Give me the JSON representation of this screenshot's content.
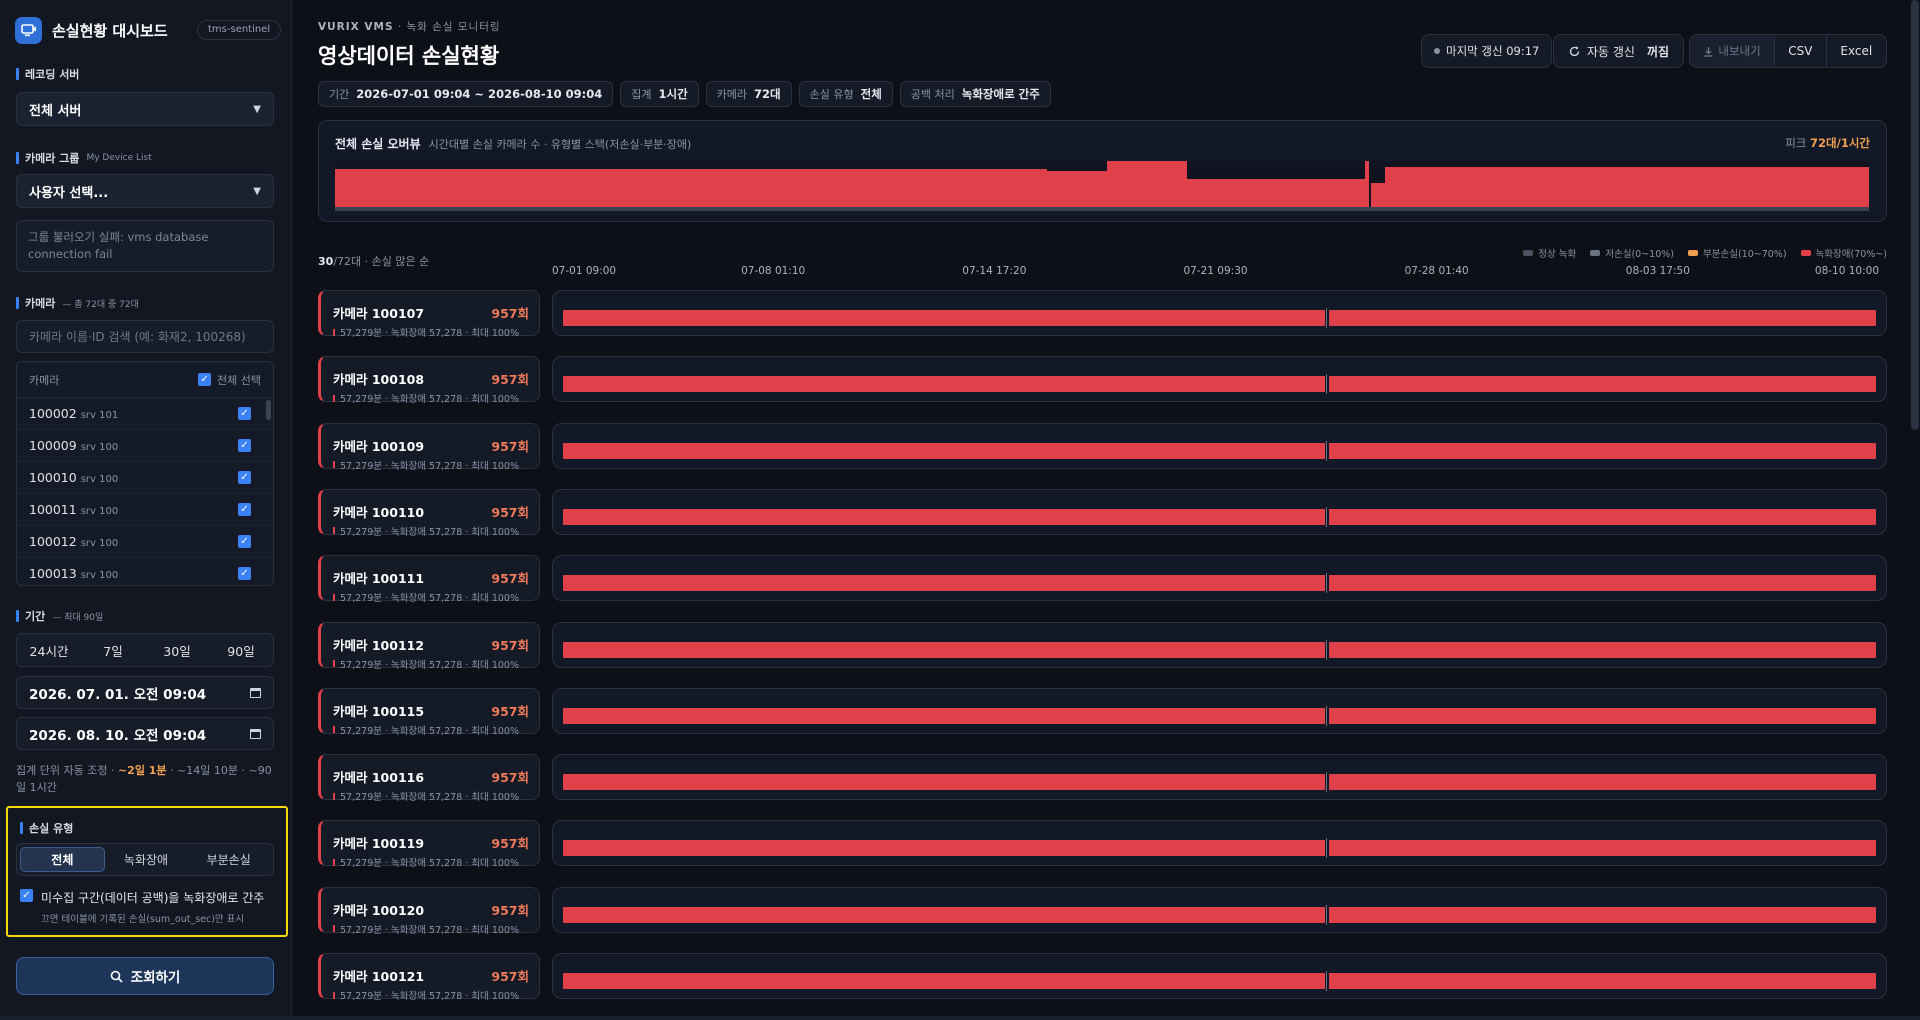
{
  "brand": {
    "title": "손실현황 대시보드",
    "badge": "tms-sentinel"
  },
  "sidebar": {
    "recording_server": {
      "label": "레코딩 서버",
      "value": "전체 서버"
    },
    "camera_group": {
      "label": "카메라 그룹",
      "sub": "My Device List",
      "value": "사용자 선택...",
      "error": "그룹 불러오기 실패: vms database connection fail"
    },
    "camera": {
      "label": "카메라",
      "sub": "— 총 72대 중 72대",
      "search_placeholder": "카메라 이름·ID 검색 (예: 화재2, 100268)",
      "col_header": "카메라",
      "select_all": "전체 선택",
      "items": [
        {
          "id": "100002",
          "srv": "srv 101"
        },
        {
          "id": "100009",
          "srv": "srv 100"
        },
        {
          "id": "100010",
          "srv": "srv 100"
        },
        {
          "id": "100011",
          "srv": "srv 100"
        },
        {
          "id": "100012",
          "srv": "srv 100"
        },
        {
          "id": "100013",
          "srv": "srv 100"
        }
      ]
    },
    "period": {
      "label": "기간",
      "sub": "— 최대 90일",
      "presets": [
        "24시간",
        "7일",
        "30일",
        "90일"
      ],
      "start": "2026. 07. 01. 오전 09:04",
      "end": "2026. 08. 10. 오전 09:04",
      "note_prefix": "집계 단위 자동 조정 · ",
      "note_hl": "~2일 1분",
      "note_suffix": " · ~14일 10분 · ~90일 1시간"
    },
    "loss_type": {
      "label": "손실 유형",
      "options": [
        "전체",
        "녹화장애",
        "부분손실"
      ],
      "active": "전체",
      "gap_check": "미수집 구간(데이터 공백)을 녹화장애로 간주",
      "gap_note": "끄면 테이블에 기록된 손실(sum_out_sec)만 표시"
    },
    "query_button": "조회하기"
  },
  "main": {
    "crumb_brand": "VURIX VMS",
    "crumb_rest": " · 녹화 손실 모니터링",
    "title": "영상데이터 손실현황",
    "last_update": "마지막 갱신 09:17",
    "auto_refresh_label": "자동 갱신",
    "auto_refresh_state": "꺼짐",
    "export": "내보내기",
    "csv": "CSV",
    "excel": "Excel",
    "chips": [
      {
        "k": "기간",
        "v": "2026-07-01 09:04 ~ 2026-08-10 09:04"
      },
      {
        "k": "집계",
        "v": "1시간"
      },
      {
        "k": "카메라",
        "v": "72대"
      },
      {
        "k": "손실 유형",
        "v": "전체"
      },
      {
        "k": "공백 처리",
        "v": "녹화장애로 간주"
      }
    ],
    "overview": {
      "title": "전체 손실 오버뷰",
      "subtitle": "시간대별 손실 카메라 수 · 유형별 스택(저손실·부분·장애)",
      "peak_label": "피크",
      "peak_value": "72대/1시간"
    },
    "list_meta": {
      "count": "30",
      "rest": "/72대 · 손실 많은 순"
    },
    "legend": [
      {
        "label": "정상 녹화",
        "color": "#4a5261"
      },
      {
        "label": "저손실(0~10%)",
        "color": "#6b7280"
      },
      {
        "label": "부분손실(10~70%)",
        "color": "#f0a050"
      },
      {
        "label": "녹화장애(70%~)",
        "color": "#e0404a"
      }
    ],
    "axis_ticks": [
      "07-01 09:00",
      "07-08 01:10",
      "07-14 17:20",
      "07-21 09:30",
      "07-28 01:40",
      "08-03 17:50",
      "08-10 10:00"
    ],
    "rows": [
      {
        "name": "카메라 100107",
        "count": "957회",
        "sub": "57,279분 · 녹화장애 57,278 · 최대 100%"
      },
      {
        "name": "카메라 100108",
        "count": "957회",
        "sub": "57,279분 · 녹화장애 57,278 · 최대 100%"
      },
      {
        "name": "카메라 100109",
        "count": "957회",
        "sub": "57,279분 · 녹화장애 57,278 · 최대 100%"
      },
      {
        "name": "카메라 100110",
        "count": "957회",
        "sub": "57,279분 · 녹화장애 57,278 · 최대 100%"
      },
      {
        "name": "카메라 100111",
        "count": "957회",
        "sub": "57,279분 · 녹화장애 57,278 · 최대 100%"
      },
      {
        "name": "카메라 100112",
        "count": "957회",
        "sub": "57,279분 · 녹화장애 57,278 · 최대 100%"
      },
      {
        "name": "카메라 100115",
        "count": "957회",
        "sub": "57,279분 · 녹화장애 57,278 · 최대 100%"
      },
      {
        "name": "카메라 100116",
        "count": "957회",
        "sub": "57,279분 · 녹화장애 57,278 · 최대 100%"
      },
      {
        "name": "카메라 100119",
        "count": "957회",
        "sub": "57,279분 · 녹화장애 57,278 · 최대 100%"
      },
      {
        "name": "카메라 100120",
        "count": "957회",
        "sub": "57,279분 · 녹화장애 57,278 · 최대 100%"
      },
      {
        "name": "카메라 100121",
        "count": "957회",
        "sub": "57,279분 · 녹화장애 57,278 · 최대 100%"
      }
    ]
  }
}
